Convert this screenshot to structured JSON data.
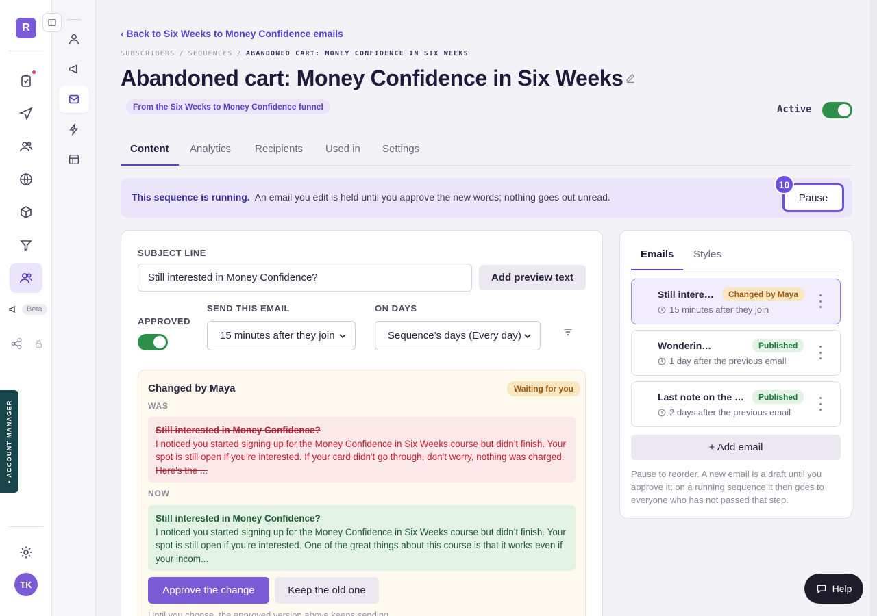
{
  "rail": {
    "logo_letter": "R",
    "beta_label": "Beta",
    "account_manager_label": "• ACCOUNT MANAGER",
    "avatar_initials": "TK"
  },
  "header": {
    "back_link": "‹ Back to Six Weeks to Money Confidence emails",
    "breadcrumb": [
      "SUBSCRIBERS",
      "/",
      "SEQUENCES",
      "/",
      "ABANDONED CART: MONEY CONFIDENCE IN SIX WEEKS"
    ],
    "title": "Abandoned cart: Money Confidence in Six Weeks",
    "funnel_badge": "From the Six Weeks to Money Confidence funnel",
    "status_label": "Active",
    "status_on": true
  },
  "tabs": [
    "Content",
    "Analytics",
    "Recipients",
    "Used in",
    "Settings"
  ],
  "banner": {
    "strong": "This sequence is running.",
    "text": "An email you edit is held until you approve the new words; nothing goes out unread.",
    "pause_label": "Pause",
    "step_number": "10"
  },
  "editor": {
    "subject_label": "SUBJECT LINE",
    "subject_value": "Still interested in Money Confidence?",
    "preview_button": "Add preview text",
    "approved_label": "APPROVED",
    "approved_on": true,
    "send_label": "SEND THIS EMAIL",
    "send_value": "15 minutes after they join",
    "days_label": "ON DAYS",
    "days_value": "Sequence’s days (Every day)",
    "change": {
      "title": "Changed by Maya",
      "badge": "Waiting for you",
      "was_label": "WAS",
      "was_subject": "Still interested in Money Confidence?",
      "was_body": "I noticed you started signing up for the Money Confidence in Six Weeks course but didn't finish. Your spot is still open if you're interested. If your card didn't go through, don't worry, nothing was charged. Here's the ...",
      "now_label": "NOW",
      "now_subject": "Still interested in Money Confidence?",
      "now_body": "I noticed you started signing up for the Money Confidence in Six Weeks course but didn't finish. Your spot is still open if you're interested. One of the great things about this course is that it works even if your incom...",
      "approve_button": "Approve the change",
      "keep_button": "Keep the old one",
      "note": "Until you choose, the approved version above keeps sending."
    }
  },
  "side": {
    "tabs": [
      "Emails",
      "Styles"
    ],
    "emails": [
      {
        "title": "Still interested in Money Confidence?",
        "badge": "Changed by Maya",
        "badge_type": "changed",
        "timing": "15 minutes after they join"
      },
      {
        "title": "Wondering if the course is right for you?",
        "badge": "Published",
        "badge_type": "pub",
        "timing": "1 day after the previous email"
      },
      {
        "title": "Last note on the course",
        "badge": "Published",
        "badge_type": "pub",
        "timing": "2 days after the previous email"
      }
    ],
    "add_button": "+ Add email",
    "note": "Pause to reorder. A new email is a draft until you approve it; on a running sequence it then goes to everyone who has not passed that step."
  },
  "help_label": "Help",
  "colors": {
    "accent": "#5b3fc8",
    "brand": "#7c5cd6",
    "success": "#2e8f4a",
    "danger": "#b3273a",
    "warning": "#9a5a10"
  }
}
